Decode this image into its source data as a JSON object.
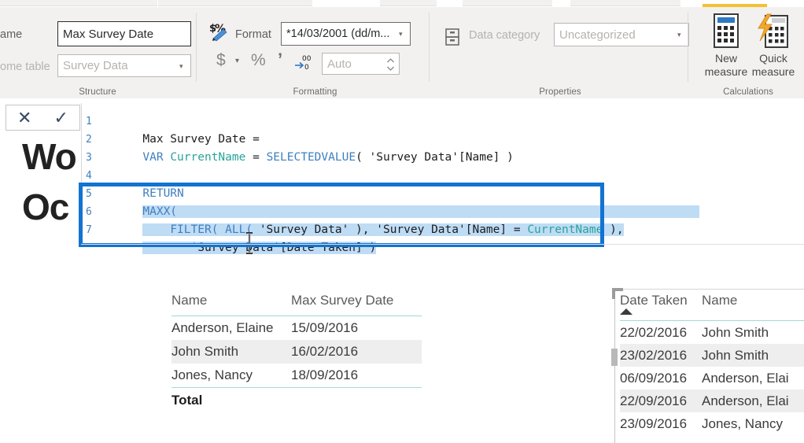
{
  "ribbon": {
    "groups": [
      {
        "label": "Structure"
      },
      {
        "label": "Formatting"
      },
      {
        "label": "Properties"
      },
      {
        "label": "Calculations"
      }
    ],
    "structure": {
      "name_label": "ame",
      "name_value": "Max Survey Date",
      "home_table_label": "ome table",
      "home_table_value": "Survey Data"
    },
    "formatting": {
      "format_icon": "currency-percent-icon",
      "format_label": "Format",
      "format_value": "*14/03/2001 (dd/m...",
      "currency_symbol": "$",
      "percent_symbol": "%",
      "thousands_symbol": "’",
      "decimal_icon": "decimal-places-icon",
      "decimal_value": "Auto"
    },
    "properties": {
      "data_category_icon": "data-category-icon",
      "data_category_label": "Data category",
      "data_category_value": "Uncategorized"
    },
    "calculations": {
      "new_measure_line1": "New",
      "new_measure_line2": "measure",
      "quick_measure_line1": "Quick",
      "quick_measure_line2": "measure"
    }
  },
  "formula_bar": {
    "cancel_icon": "✕",
    "accept_icon": "✓",
    "lines": [
      {
        "num": "1",
        "text": "Max Survey Date ="
      },
      {
        "num": "2",
        "text": "VAR CurrentName = SELECTEDVALUE( 'Survey Data'[Name] )"
      },
      {
        "num": "3",
        "text": ""
      },
      {
        "num": "4",
        "text": "RETURN"
      },
      {
        "num": "5",
        "text": "MAXX("
      },
      {
        "num": "6",
        "text": "    FILTER( ALL( 'Survey Data' ), 'Survey Data'[Name] = CurrentName ),"
      },
      {
        "num": "7",
        "text": "        'Survey Data'[Date Taken] )"
      }
    ],
    "tokens": {
      "measure_name": "Max Survey Date =",
      "var_kw": "VAR",
      "var_name": "CurrentName",
      "selectedvalue": "SELECTEDVALUE",
      "return_kw": "RETURN",
      "maxx": "MAXX(",
      "filter": "FILTER(",
      "all": "ALL(",
      "survey_data": "'Survey Data'",
      "name_col": "[Name]",
      "date_taken_col": "'Survey Data'[Date Taken] )",
      "current_name": "CurrentName"
    }
  },
  "background_text": {
    "line1": "Wo",
    "line2": "Oc"
  },
  "table_left": {
    "headers": [
      "Name",
      "Max Survey Date"
    ],
    "rows": [
      [
        "Anderson, Elaine",
        "15/09/2016"
      ],
      [
        "John Smith",
        "16/02/2016"
      ],
      [
        "Jones, Nancy",
        "18/09/2016"
      ]
    ],
    "total_label": "Total",
    "total_value": ""
  },
  "table_right": {
    "headers": [
      "Date Taken",
      "Name"
    ],
    "sort_column": "Date Taken",
    "sort_direction": "ascending",
    "rows": [
      [
        "22/02/2016",
        "John Smith"
      ],
      [
        "23/02/2016",
        "John Smith"
      ],
      [
        "06/09/2016",
        "Anderson, Elai"
      ],
      [
        "22/09/2016",
        "Anderson, Elai"
      ],
      [
        "23/09/2016",
        "Jones, Nancy"
      ]
    ]
  },
  "colors": {
    "ribbon_bg": "#f3f1f0",
    "tab_accent": "#f2c233",
    "annotation": "#1273d1",
    "selection_highlight": "#bfdcf5",
    "table_rule": "#9fd8d3",
    "code_keyword": "#3f7fbf",
    "code_variable": "#29a39a"
  }
}
